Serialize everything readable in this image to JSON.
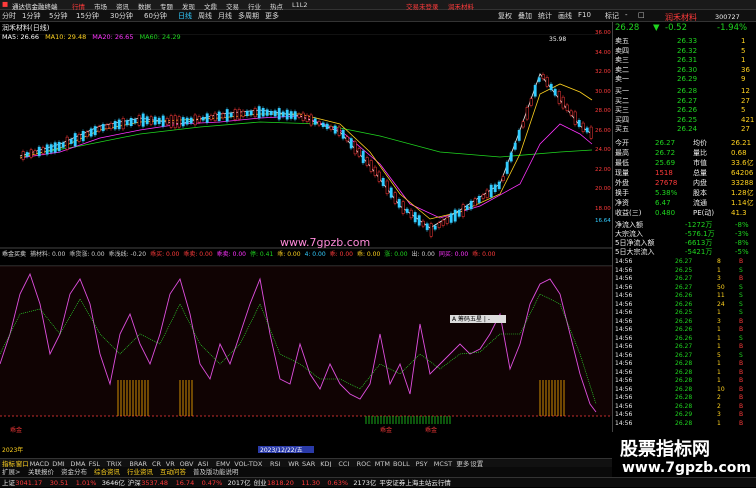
{
  "topbar": {
    "app_title": "通达信金融终端",
    "menus": [
      "行情",
      "市场",
      "资讯",
      "数据",
      "专题",
      "发现",
      "文鼎",
      "交易",
      "行业",
      "热点",
      "L1L2"
    ],
    "status_left": "交易未登录",
    "status_right": "润禾材料"
  },
  "menubar": {
    "items": [
      "分时",
      "1分钟",
      "5分钟",
      "15分钟",
      "30分钟",
      "60分钟",
      "日线",
      "周线",
      "月线",
      "多周期",
      "更多"
    ],
    "right_items": [
      "复权",
      "叠加",
      "统计",
      "画线",
      "F10",
      "标记",
      "-",
      "□"
    ]
  },
  "title": {
    "stock_line": "润禾材料(日线)",
    "indicators": [
      {
        "label": "MA5: 26.66",
        "color": "#fff"
      },
      {
        "label": "MA10: 29.48",
        "color": "#ffd21f"
      },
      {
        "label": "MA20: 26.65",
        "color": "#f3f"
      },
      {
        "label": "MA60: 24.29",
        "color": "#1fd51f"
      }
    ]
  },
  "chart": {
    "price_labels": [
      "36.00",
      "34.00",
      "32.00",
      "30.00",
      "28.00",
      "26.00",
      "24.00",
      "22.00",
      "20.00",
      "18.00",
      "16.64"
    ],
    "peak_label": "35.98",
    "low_label": "16.64",
    "watermark": "www.7gpzb.com"
  },
  "indicator_line": {
    "parts": [
      {
        "t": "乖金买卖",
        "c": "#eee"
      },
      {
        "t": "捕材料: 0.00",
        "c": "#ccc"
      },
      {
        "t": "乖货涨: 0.00",
        "c": "#ccc"
      },
      {
        "t": "乖浅线: -0.20",
        "c": "#ccc"
      },
      {
        "t": "乖买: 0.00",
        "c": "#ff3b3b"
      },
      {
        "t": "乖卖: 0.00",
        "c": "#ff3b3b"
      },
      {
        "t": "乖卖: 0.00",
        "c": "#f3f"
      },
      {
        "t": "停: 0.41",
        "c": "#1fd51f"
      },
      {
        "t": "乖: 0.00",
        "c": "#ffd21f"
      },
      {
        "t": "4: 0.00",
        "c": "#3cf"
      },
      {
        "t": "乖: 0.00",
        "c": "#ff3b3b"
      },
      {
        "t": "乖: 0.00",
        "c": "#ffd21f"
      },
      {
        "t": "涨: 0.00",
        "c": "#1fd51f"
      },
      {
        "t": "出: 0.00",
        "c": "#ccc"
      },
      {
        "t": "同买: 0.00",
        "c": "#f3f"
      },
      {
        "t": "乖: 0.00",
        "c": "#ff3b3b"
      }
    ]
  },
  "sub_labels": {
    "popup": "A 筹码五星 | -",
    "buy": "乖金",
    "buy2": "乖金",
    "buy3": "乖金",
    "date": "2023/12/22/五",
    "year": "2023年"
  },
  "right_panel": {
    "header": {
      "name": "润禾材料",
      "code": "300727",
      "price": "26.28",
      "arrow": "▼",
      "change": "-0.52",
      "pct": "-1.94%"
    },
    "sell": [
      {
        "l": "卖五",
        "p": "26.33",
        "v": "1"
      },
      {
        "l": "卖四",
        "p": "26.32",
        "v": "5"
      },
      {
        "l": "卖三",
        "p": "26.31",
        "v": "1"
      },
      {
        "l": "卖二",
        "p": "26.30",
        "v": "36"
      },
      {
        "l": "卖一",
        "p": "26.29",
        "v": "9"
      }
    ],
    "buy": [
      {
        "l": "买一",
        "p": "26.28",
        "v": "12"
      },
      {
        "l": "买二",
        "p": "26.27",
        "v": "27"
      },
      {
        "l": "买三",
        "p": "26.26",
        "v": "5"
      },
      {
        "l": "买四",
        "p": "26.25",
        "v": "421"
      },
      {
        "l": "买五",
        "p": "26.24",
        "v": "27"
      }
    ],
    "stats": [
      {
        "a": "今开",
        "b": "26.27",
        "c": "均价",
        "d": "26.21"
      },
      {
        "a": "最高",
        "b": "26.72",
        "c": "量比",
        "d": "0.68"
      },
      {
        "a": "最低",
        "b": "25.69",
        "c": "市值",
        "d": "33.6亿"
      },
      {
        "a": "现量",
        "b": "1518",
        "c": "总量",
        "d": "64206"
      },
      {
        "a": "外盘",
        "b": "27678",
        "c": "内盘",
        "d": "33288"
      },
      {
        "a": "换手",
        "b": "5.38%",
        "c": "股本",
        "d": "1.28亿"
      },
      {
        "a": "净资",
        "b": "6.47",
        "c": "流通",
        "d": "1.14亿"
      },
      {
        "a": "收益(三)",
        "b": "0.480",
        "c": "PE(动)",
        "d": "41.3"
      }
    ],
    "flows": [
      {
        "a": "净流入额",
        "b": "-1272万",
        "c": "-8%"
      },
      {
        "a": "大宗流入",
        "b": "-576.1万",
        "c": "-3%"
      },
      {
        "a": "5日净流入额",
        "b": "-6613万",
        "c": "-8%"
      },
      {
        "a": "5日大宗流入",
        "b": "-5421万",
        "c": "-5%"
      }
    ],
    "ticks": [
      {
        "t": "14:56",
        "p": "26.27",
        "v": "8",
        "f": "B"
      },
      {
        "t": "14:56",
        "p": "26.25",
        "v": "1",
        "f": "S"
      },
      {
        "t": "14:56",
        "p": "26.27",
        "v": "3",
        "f": "B"
      },
      {
        "t": "14:56",
        "p": "26.27",
        "v": "50",
        "f": "S"
      },
      {
        "t": "14:56",
        "p": "26.26",
        "v": "11",
        "f": "S"
      },
      {
        "t": "14:56",
        "p": "26.26",
        "v": "24",
        "f": "S"
      },
      {
        "t": "14:56",
        "p": "26.25",
        "v": "1",
        "f": "S"
      },
      {
        "t": "14:56",
        "p": "26.26",
        "v": "3",
        "f": "B"
      },
      {
        "t": "14:56",
        "p": "26.26",
        "v": "1",
        "f": "B"
      },
      {
        "t": "14:56",
        "p": "26.26",
        "v": "1",
        "f": "S"
      },
      {
        "t": "14:56",
        "p": "26.27",
        "v": "1",
        "f": "B"
      },
      {
        "t": "14:56",
        "p": "26.27",
        "v": "5",
        "f": "S"
      },
      {
        "t": "14:56",
        "p": "26.28",
        "v": "1",
        "f": "B"
      },
      {
        "t": "14:56",
        "p": "26.28",
        "v": "1",
        "f": "B"
      },
      {
        "t": "14:56",
        "p": "26.28",
        "v": "1",
        "f": "B"
      },
      {
        "t": "14:56",
        "p": "26.28",
        "v": "10",
        "f": "B"
      },
      {
        "t": "14:56",
        "p": "26.28",
        "v": "2",
        "f": "B"
      },
      {
        "t": "14:56",
        "p": "26.28",
        "v": "2",
        "f": "B"
      },
      {
        "t": "14:56",
        "p": "26.29",
        "v": "3",
        "f": "B"
      },
      {
        "t": "14:56",
        "p": "26.28",
        "v": "1",
        "f": "B"
      }
    ]
  },
  "tabs1": [
    "指标",
    "窗口",
    "MACD",
    "DMI",
    "DMA",
    "FSL",
    "TRIX",
    "BRAR",
    "CR",
    "VR",
    "OBV",
    "ASI",
    "EMV",
    "VOL-TDX",
    "RSI",
    "WR",
    "SAR",
    "KDJ",
    "CCI",
    "ROC",
    "MTM",
    "BOLL",
    "PSY",
    "MCST",
    "更多",
    "设置"
  ],
  "tabs2": [
    "扩展>",
    "关联报价",
    "资金分布",
    "综合资讯",
    "行业资讯",
    "互动问答",
    "普及版功能说明"
  ],
  "bottombar": [
    {
      "t": "上证",
      "c": "#eee"
    },
    {
      "t": "3041.17",
      "c": "#ff3b3b"
    },
    {
      "t": "30.51",
      "c": "#ff3b3b"
    },
    {
      "t": "1.01%",
      "c": "#ff3b3b"
    },
    {
      "t": "3646亿",
      "c": "#eee"
    },
    {
      "t": "沪深",
      "c": "#eee"
    },
    {
      "t": "3537.48",
      "c": "#ff3b3b"
    },
    {
      "t": "16.74",
      "c": "#ff3b3b"
    },
    {
      "t": "0.47%",
      "c": "#ff3b3b"
    },
    {
      "t": "2017亿",
      "c": "#eee"
    },
    {
      "t": "创业",
      "c": "#eee"
    },
    {
      "t": "1818.20",
      "c": "#ff3b3b"
    },
    {
      "t": "11.30",
      "c": "#ff3b3b"
    },
    {
      "t": "0.63%",
      "c": "#ff3b3b"
    },
    {
      "t": "2173亿",
      "c": "#eee"
    },
    {
      "t": "平安证券上海主站云行情",
      "c": "#eee"
    }
  ],
  "ad": {
    "title": "股票指标网",
    "url": "www.7gpzb.com"
  }
}
